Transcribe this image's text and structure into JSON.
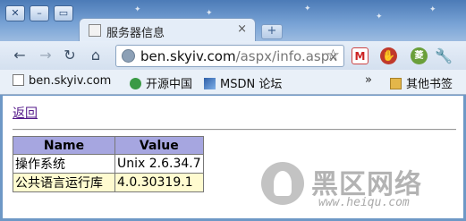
{
  "window": {
    "controls": {
      "close": "✕",
      "minimize": "–",
      "maximize": "▭"
    }
  },
  "tab": {
    "title": "服务器信息",
    "close": "×"
  },
  "new_tab": "+",
  "toolbar": {
    "back": "←",
    "forward": "→",
    "reload": "↻",
    "home": "⌂",
    "url_host": "ben.skyiv.com",
    "url_path": "/aspx/info.aspx",
    "star": "☆",
    "gmail": "M",
    "adblock": "✋",
    "veg": "菱",
    "wrench": "🔧"
  },
  "bookmarks": {
    "items": [
      {
        "label": "ben.skyiv.com"
      },
      {
        "label": "开源中国"
      },
      {
        "label": "MSDN 论坛"
      }
    ],
    "overflow": "»",
    "other": "其他书签"
  },
  "page": {
    "back_link": "返回",
    "table": {
      "headers": [
        "Name",
        "Value"
      ],
      "rows": [
        [
          "操作系统",
          "Unix 2.6.34.7"
        ],
        [
          "公共语言运行库",
          "4.0.30319.1"
        ]
      ]
    }
  },
  "watermark": {
    "text": "黑区网络",
    "url": "www.heiqu.com"
  }
}
